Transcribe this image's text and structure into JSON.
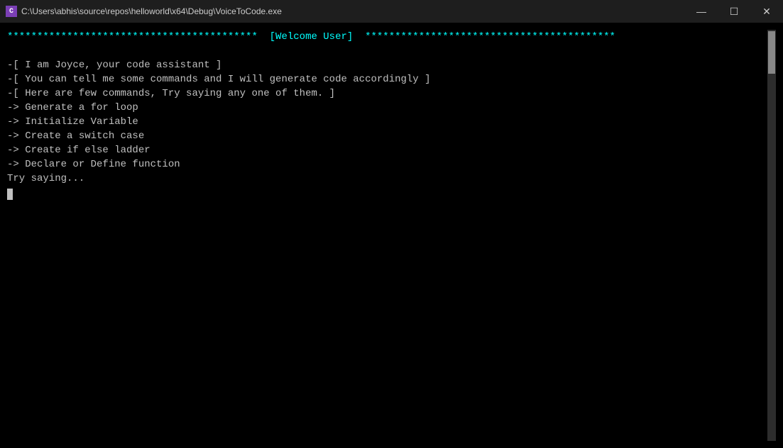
{
  "titlebar": {
    "icon_label": "C",
    "title": "C:\\Users\\abhis\\source\\repos\\helloworld\\x64\\Debug\\VoiceToCode.exe",
    "minimize_label": "—",
    "restore_label": "☐",
    "close_label": "✕"
  },
  "console": {
    "welcome_line": "******************************************  [Welcome User]  ******************************************",
    "line1": "-[ I am Joyce, your code assistant ]",
    "line2": "-[ You can tell me some commands and I will generate code accordingly ]",
    "line3": "-[ Here are few commands, Try saying any one of them. ]",
    "cmd1": "-> Generate a for loop",
    "cmd2": "-> Initialize Variable",
    "cmd3": "-> Create a switch case",
    "cmd4": "-> Create if else ladder",
    "cmd5": "-> Declare or Define function",
    "prompt": "Try saying...",
    "cursor": ""
  }
}
